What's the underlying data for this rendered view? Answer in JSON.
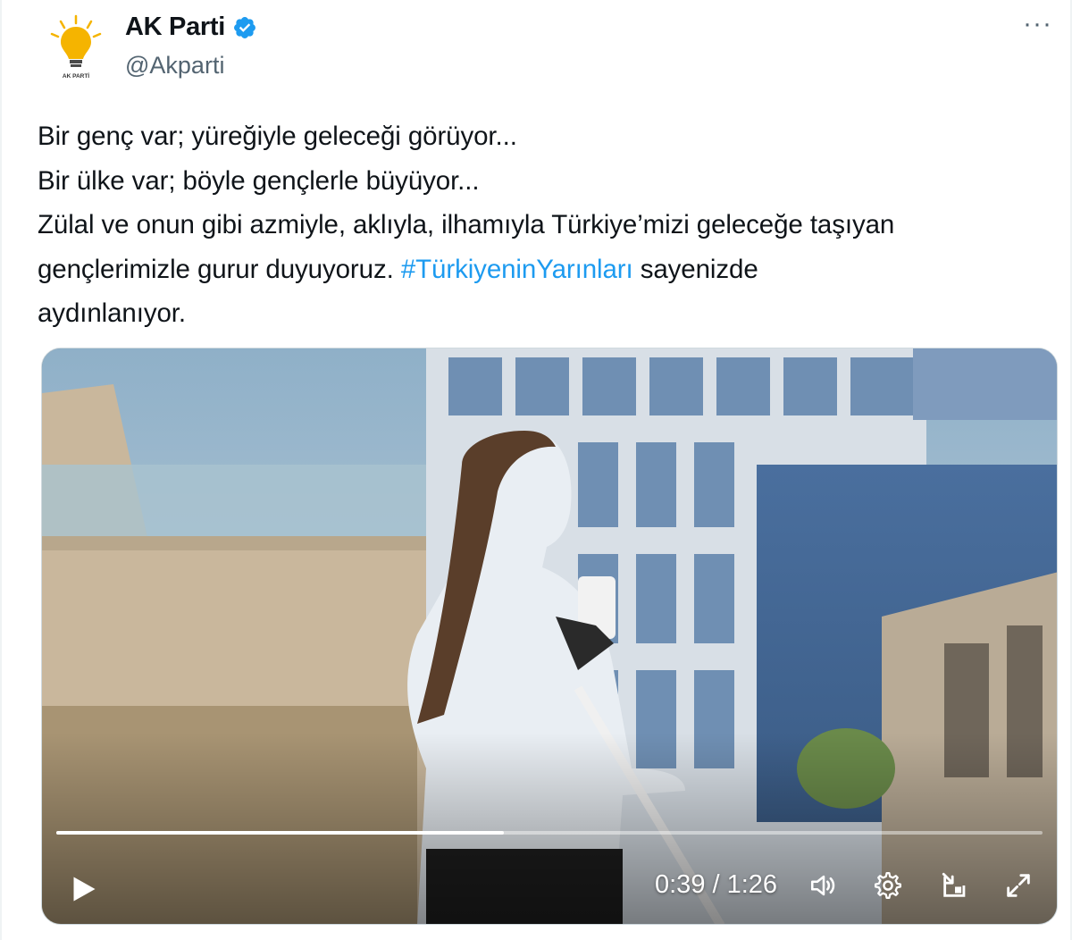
{
  "author": {
    "display_name": "AK Parti",
    "handle": "@Akparti",
    "verified": true,
    "avatar_icon": "ak-parti-lightbulb-logo",
    "avatar_text": "AK PARTİ"
  },
  "more_icon": "more-horizontal-icon",
  "more_label": "···",
  "tweet": {
    "line1": "Bir genç var; yüreğiyle geleceği görüyor...",
    "line2": "Bir ülke var; böyle gençlerle büyüyor...",
    "line3": "Zülal ve onun gibi azmiyle, aklıyla, ilhamıyla Türkiye’mizi geleceğe taşıyan",
    "line4_before": "gençlerimizle gurur duyuyoruz. ",
    "hashtag": "#TürkiyeninYarınları",
    "line4_after": " sayenizde",
    "line5": "aydınlanıyor."
  },
  "video": {
    "current_time": "0:39",
    "duration": "1:26",
    "time_display": "0:39 / 1:26",
    "progress": 0.4535,
    "controls": [
      "play-icon",
      "volume-icon",
      "settings-gear-icon",
      "picture-in-picture-icon",
      "fullscreen-icon"
    ]
  },
  "colors": {
    "hashtag": "#1d9bf0",
    "verified_badge": "#1d9bf0",
    "secondary_text": "#536471",
    "logo_yellow": "#f5b400"
  }
}
